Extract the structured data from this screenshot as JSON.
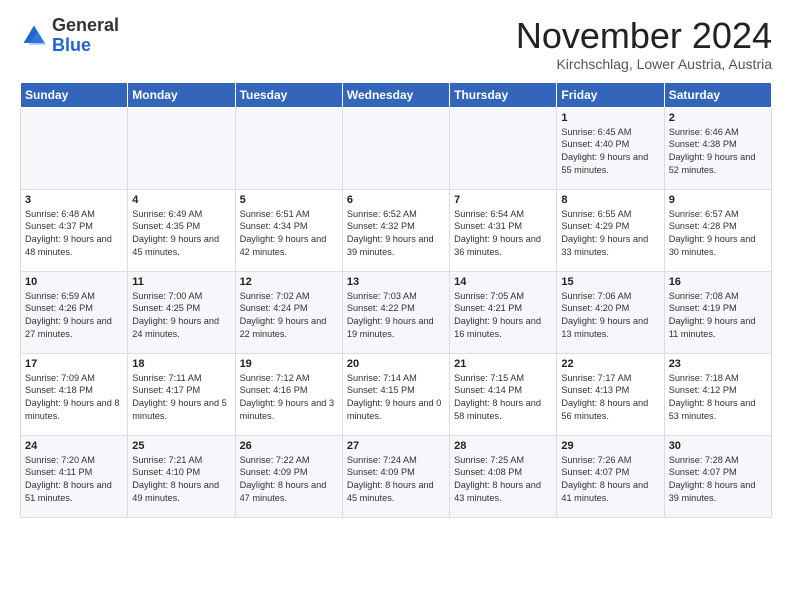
{
  "header": {
    "logo_general": "General",
    "logo_blue": "Blue",
    "month_title": "November 2024",
    "location": "Kirchschlag, Lower Austria, Austria"
  },
  "days_of_week": [
    "Sunday",
    "Monday",
    "Tuesday",
    "Wednesday",
    "Thursday",
    "Friday",
    "Saturday"
  ],
  "weeks": [
    [
      {
        "day": "",
        "content": ""
      },
      {
        "day": "",
        "content": ""
      },
      {
        "day": "",
        "content": ""
      },
      {
        "day": "",
        "content": ""
      },
      {
        "day": "",
        "content": ""
      },
      {
        "day": "1",
        "content": "Sunrise: 6:45 AM\nSunset: 4:40 PM\nDaylight: 9 hours and 55 minutes."
      },
      {
        "day": "2",
        "content": "Sunrise: 6:46 AM\nSunset: 4:38 PM\nDaylight: 9 hours and 52 minutes."
      }
    ],
    [
      {
        "day": "3",
        "content": "Sunrise: 6:48 AM\nSunset: 4:37 PM\nDaylight: 9 hours and 48 minutes."
      },
      {
        "day": "4",
        "content": "Sunrise: 6:49 AM\nSunset: 4:35 PM\nDaylight: 9 hours and 45 minutes."
      },
      {
        "day": "5",
        "content": "Sunrise: 6:51 AM\nSunset: 4:34 PM\nDaylight: 9 hours and 42 minutes."
      },
      {
        "day": "6",
        "content": "Sunrise: 6:52 AM\nSunset: 4:32 PM\nDaylight: 9 hours and 39 minutes."
      },
      {
        "day": "7",
        "content": "Sunrise: 6:54 AM\nSunset: 4:31 PM\nDaylight: 9 hours and 36 minutes."
      },
      {
        "day": "8",
        "content": "Sunrise: 6:55 AM\nSunset: 4:29 PM\nDaylight: 9 hours and 33 minutes."
      },
      {
        "day": "9",
        "content": "Sunrise: 6:57 AM\nSunset: 4:28 PM\nDaylight: 9 hours and 30 minutes."
      }
    ],
    [
      {
        "day": "10",
        "content": "Sunrise: 6:59 AM\nSunset: 4:26 PM\nDaylight: 9 hours and 27 minutes."
      },
      {
        "day": "11",
        "content": "Sunrise: 7:00 AM\nSunset: 4:25 PM\nDaylight: 9 hours and 24 minutes."
      },
      {
        "day": "12",
        "content": "Sunrise: 7:02 AM\nSunset: 4:24 PM\nDaylight: 9 hours and 22 minutes."
      },
      {
        "day": "13",
        "content": "Sunrise: 7:03 AM\nSunset: 4:22 PM\nDaylight: 9 hours and 19 minutes."
      },
      {
        "day": "14",
        "content": "Sunrise: 7:05 AM\nSunset: 4:21 PM\nDaylight: 9 hours and 16 minutes."
      },
      {
        "day": "15",
        "content": "Sunrise: 7:06 AM\nSunset: 4:20 PM\nDaylight: 9 hours and 13 minutes."
      },
      {
        "day": "16",
        "content": "Sunrise: 7:08 AM\nSunset: 4:19 PM\nDaylight: 9 hours and 11 minutes."
      }
    ],
    [
      {
        "day": "17",
        "content": "Sunrise: 7:09 AM\nSunset: 4:18 PM\nDaylight: 9 hours and 8 minutes."
      },
      {
        "day": "18",
        "content": "Sunrise: 7:11 AM\nSunset: 4:17 PM\nDaylight: 9 hours and 5 minutes."
      },
      {
        "day": "19",
        "content": "Sunrise: 7:12 AM\nSunset: 4:16 PM\nDaylight: 9 hours and 3 minutes."
      },
      {
        "day": "20",
        "content": "Sunrise: 7:14 AM\nSunset: 4:15 PM\nDaylight: 9 hours and 0 minutes."
      },
      {
        "day": "21",
        "content": "Sunrise: 7:15 AM\nSunset: 4:14 PM\nDaylight: 8 hours and 58 minutes."
      },
      {
        "day": "22",
        "content": "Sunrise: 7:17 AM\nSunset: 4:13 PM\nDaylight: 8 hours and 56 minutes."
      },
      {
        "day": "23",
        "content": "Sunrise: 7:18 AM\nSunset: 4:12 PM\nDaylight: 8 hours and 53 minutes."
      }
    ],
    [
      {
        "day": "24",
        "content": "Sunrise: 7:20 AM\nSunset: 4:11 PM\nDaylight: 8 hours and 51 minutes."
      },
      {
        "day": "25",
        "content": "Sunrise: 7:21 AM\nSunset: 4:10 PM\nDaylight: 8 hours and 49 minutes."
      },
      {
        "day": "26",
        "content": "Sunrise: 7:22 AM\nSunset: 4:09 PM\nDaylight: 8 hours and 47 minutes."
      },
      {
        "day": "27",
        "content": "Sunrise: 7:24 AM\nSunset: 4:09 PM\nDaylight: 8 hours and 45 minutes."
      },
      {
        "day": "28",
        "content": "Sunrise: 7:25 AM\nSunset: 4:08 PM\nDaylight: 8 hours and 43 minutes."
      },
      {
        "day": "29",
        "content": "Sunrise: 7:26 AM\nSunset: 4:07 PM\nDaylight: 8 hours and 41 minutes."
      },
      {
        "day": "30",
        "content": "Sunrise: 7:28 AM\nSunset: 4:07 PM\nDaylight: 8 hours and 39 minutes."
      }
    ]
  ]
}
